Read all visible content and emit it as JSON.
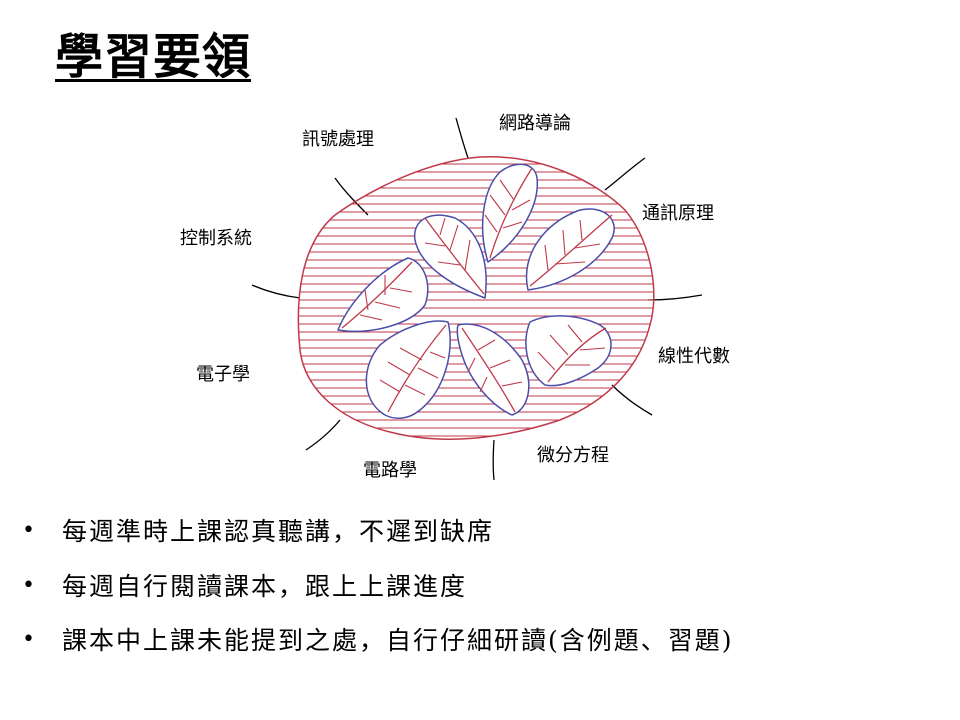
{
  "slide": {
    "title": "學習要領"
  },
  "diagram": {
    "labels": {
      "signal_processing": "訊號處理",
      "network_intro": "網路導論",
      "communication_principles": "通訊原理",
      "control_systems": "控制系統",
      "linear_algebra": "線性代數",
      "electronics": "電子學",
      "differential_equations": "微分方程",
      "circuits": "電路學"
    },
    "colors": {
      "hatch": "#c0394a",
      "leaf_outline": "#4a4fa8",
      "stem": "#000000"
    }
  },
  "bullets": [
    "每週準時上課認真聽講，不遲到缺席",
    "每週自行閱讀課本，跟上上課進度",
    "課本中上課未能提到之處，自行仔細研讀(含例題、習題)"
  ]
}
